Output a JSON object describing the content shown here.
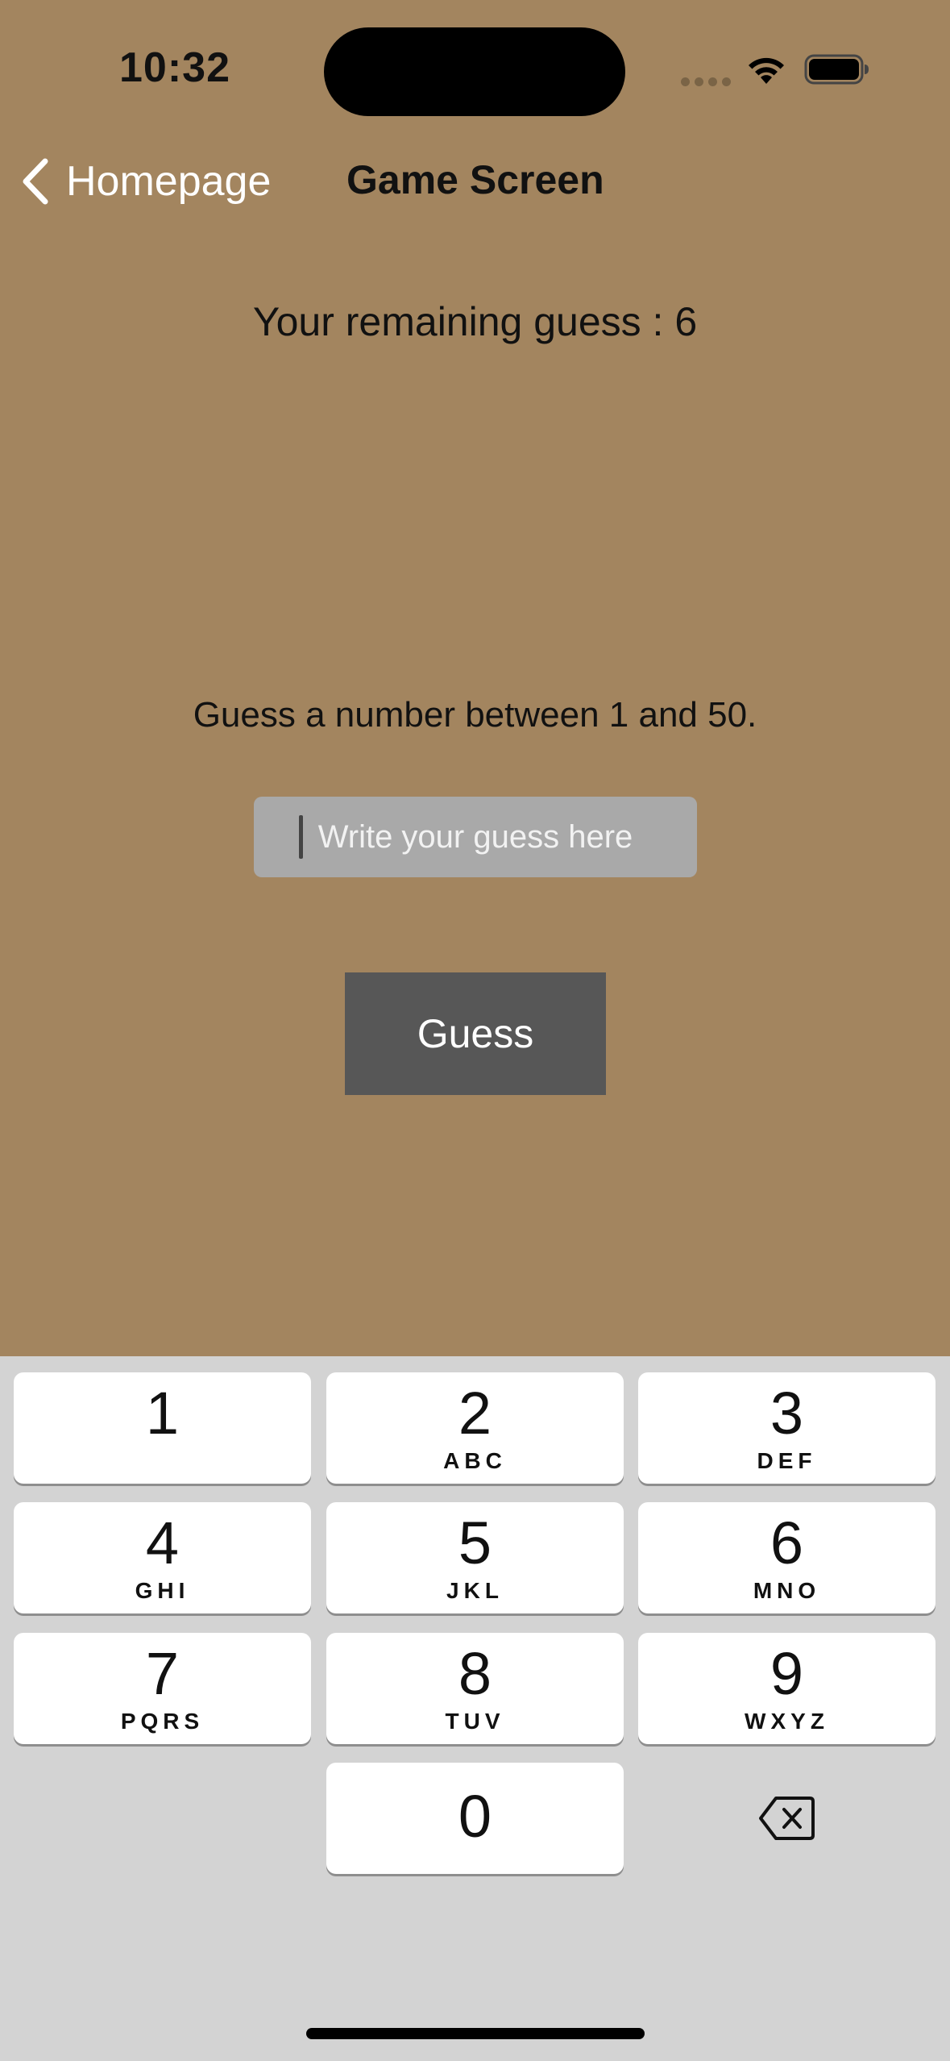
{
  "status_bar": {
    "time": "10:32",
    "wifi_icon": "wifi-icon",
    "battery_icon": "battery-icon"
  },
  "nav": {
    "back_label": "Homepage",
    "back_icon": "chevron-left-icon",
    "title": "Game Screen"
  },
  "game": {
    "remaining_text": "Your remaining guess : 6",
    "prompt_text": "Guess a number between 1 and 50.",
    "input_placeholder": "Write your guess here",
    "input_value": "",
    "button_label": "Guess"
  },
  "colors": {
    "background": "#a3855f",
    "input_bg": "#a9a9a9",
    "button_bg": "#575757",
    "keyboard_bg": "#d3d3d3"
  },
  "keyboard": {
    "keys": [
      {
        "digit": "1",
        "letters": ""
      },
      {
        "digit": "2",
        "letters": "ABC"
      },
      {
        "digit": "3",
        "letters": "DEF"
      },
      {
        "digit": "4",
        "letters": "GHI"
      },
      {
        "digit": "5",
        "letters": "JKL"
      },
      {
        "digit": "6",
        "letters": "MNO"
      },
      {
        "digit": "7",
        "letters": "PQRS"
      },
      {
        "digit": "8",
        "letters": "TUV"
      },
      {
        "digit": "9",
        "letters": "WXYZ"
      },
      {
        "digit": "0",
        "letters": ""
      }
    ],
    "delete_icon": "backspace-icon"
  }
}
